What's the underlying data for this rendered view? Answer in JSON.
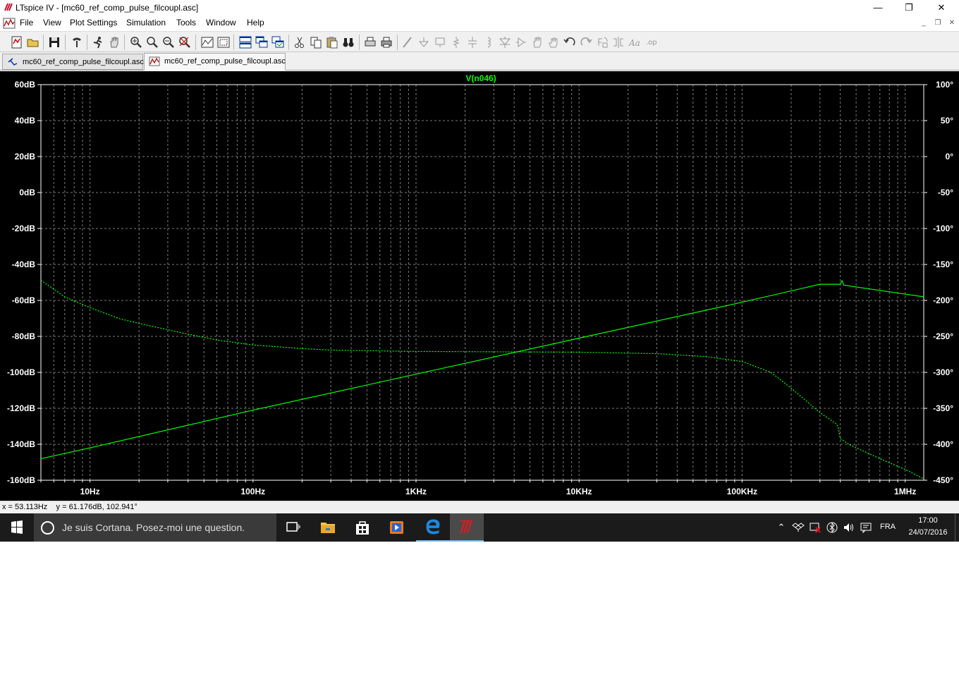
{
  "window": {
    "title": "LTspice IV - [mc60_ref_comp_pulse_filcoupl.asc]",
    "minimize_glyph": "—",
    "maximize_glyph": "❐",
    "close_glyph": "✕"
  },
  "menu": {
    "items": [
      "File",
      "View",
      "Plot Settings",
      "Simulation",
      "Tools",
      "Window",
      "Help"
    ],
    "mdi_controls": [
      "_",
      "❐",
      "✕"
    ]
  },
  "toolbar": {
    "buttons": [
      "new-schematic",
      "open",
      "save",
      "control-panel",
      "run",
      "halt",
      "zoom-in",
      "zoom-back",
      "zoom-out",
      "zoom-fit",
      "autorange",
      "mark-unused",
      "tile-horizontal",
      "cascade",
      "tile-vertical",
      "cut",
      "copy",
      "paste",
      "find",
      "print-preview",
      "print",
      "draw-wire",
      "ground",
      "label-net",
      "resistor",
      "capacitor",
      "inductor",
      "diode",
      "component",
      "move",
      "drag",
      "undo",
      "redo",
      "rotate",
      "mirror",
      "text",
      "spice-directive"
    ]
  },
  "tabs": [
    {
      "label": "mc60_ref_comp_pulse_filcoupl.asc",
      "icon": "schematic-icon",
      "active": false
    },
    {
      "label": "mc60_ref_comp_pulse_filcoupl.asc",
      "icon": "waveform-icon",
      "active": true
    }
  ],
  "colors": {
    "trace": "#00ff00",
    "grid": "#7c7c7c",
    "background": "#000000",
    "axis_text": "#ffffff"
  },
  "chart_data": {
    "type": "line",
    "title": "V(n046)",
    "x_scale": "log",
    "x_range": [
      5,
      1300000
    ],
    "x_ticks": [
      10,
      100,
      1000,
      10000,
      100000,
      1000000
    ],
    "x_tick_labels": [
      "10Hz",
      "100Hz",
      "1KHz",
      "10KHz",
      "100KHz",
      "1MHz"
    ],
    "y_left_range": [
      -160,
      60
    ],
    "y_left_ticks": [
      60,
      40,
      20,
      0,
      -20,
      -40,
      -60,
      -80,
      -100,
      -120,
      -140,
      -160
    ],
    "y_left_tick_labels": [
      "60dB",
      "40dB",
      "20dB",
      "0dB",
      "-20dB",
      "-40dB",
      "-60dB",
      "-80dB",
      "-100dB",
      "-120dB",
      "-140dB",
      "-160dB"
    ],
    "y_right_range": [
      -450,
      100
    ],
    "y_right_ticks": [
      100,
      50,
      0,
      -50,
      -100,
      -150,
      -200,
      -250,
      -300,
      -350,
      -400,
      -450
    ],
    "y_right_tick_labels": [
      "100°",
      "50°",
      "0°",
      "-50°",
      "-100°",
      "-150°",
      "-200°",
      "-250°",
      "-300°",
      "-350°",
      "-400°",
      "-450°"
    ],
    "grid": true,
    "series": [
      {
        "kind": "magnitude",
        "axis": "left",
        "line_style": "solid",
        "points": [
          [
            5,
            -148
          ],
          [
            10,
            -142
          ],
          [
            100,
            -121
          ],
          [
            1000,
            -101
          ],
          [
            10000,
            -81
          ],
          [
            100000,
            -61
          ],
          [
            300000,
            -51
          ],
          [
            400000,
            -51
          ],
          [
            410000,
            -49
          ],
          [
            420000,
            -51.5
          ],
          [
            1300000,
            -58
          ]
        ]
      },
      {
        "kind": "phase",
        "axis": "right",
        "line_style": "dashed",
        "points": [
          [
            5,
            -172
          ],
          [
            7,
            -195
          ],
          [
            10,
            -210
          ],
          [
            15,
            -225
          ],
          [
            20,
            -232
          ],
          [
            40,
            -247
          ],
          [
            60,
            -255
          ],
          [
            100,
            -262
          ],
          [
            200,
            -267
          ],
          [
            300,
            -269
          ],
          [
            1000,
            -271
          ],
          [
            3000,
            -271.5
          ],
          [
            10000,
            -272
          ],
          [
            30000,
            -274
          ],
          [
            60000,
            -278
          ],
          [
            100000,
            -285
          ],
          [
            150000,
            -300
          ],
          [
            200000,
            -322
          ],
          [
            300000,
            -356
          ],
          [
            380000,
            -372
          ],
          [
            390000,
            -378
          ],
          [
            400000,
            -392
          ],
          [
            450000,
            -400
          ],
          [
            700000,
            -420
          ],
          [
            1000000,
            -435
          ],
          [
            1300000,
            -448
          ]
        ]
      }
    ]
  },
  "status": {
    "cursor_readout": "x = 53.113Hz    y = 61.176dB, 102.941°"
  },
  "taskbar": {
    "cortana_placeholder": "Je suis Cortana. Posez-moi une question.",
    "apps": [
      "task-view",
      "file-explorer",
      "store",
      "media-player",
      "edge",
      "ltspice"
    ],
    "language": "FRA",
    "time": "17:00",
    "date": "24/07/2016"
  }
}
